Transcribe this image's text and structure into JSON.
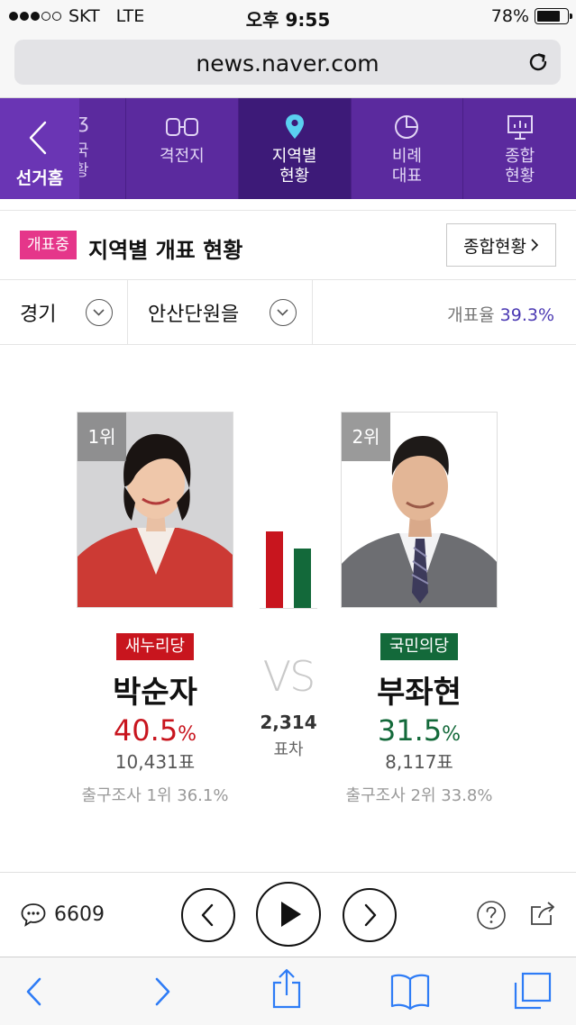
{
  "status": {
    "carrier": "SKT",
    "network": "LTE",
    "time": "오후 9:55",
    "battery": "78%"
  },
  "browser": {
    "url": "news.naver.com"
  },
  "nav": {
    "home_label": "선거홈",
    "partial_label": "국\n황",
    "tabs": [
      {
        "label": "격전지",
        "icon": "versus-icon",
        "active": false
      },
      {
        "label": "지역별\n현황",
        "icon": "location-pin-icon",
        "active": true
      },
      {
        "label": "비례\n대표",
        "icon": "pie-chart-icon",
        "active": false
      },
      {
        "label": "종합\n현황",
        "icon": "board-chart-icon",
        "active": false
      }
    ]
  },
  "header": {
    "badge": "개표중",
    "title": "지역별 개표 현황",
    "summary_button": "종합현황"
  },
  "filters": {
    "region": "경기",
    "district": "안산단원을",
    "count_rate_label": "개표율",
    "count_rate_value": "39.3%"
  },
  "candidates": [
    {
      "rank": "1위",
      "party": "새누리당",
      "name": "박순자",
      "percent": "40.5",
      "pct_sign": "%",
      "votes": "10,431표",
      "exit_poll": "출구조사 1위 36.1%",
      "color": "#c8151e"
    },
    {
      "rank": "2위",
      "party": "국민의당",
      "name": "부좌현",
      "percent": "31.5",
      "pct_sign": "%",
      "votes": "8,117표",
      "exit_poll": "출구조사 2위 33.8%",
      "color": "#13693a"
    }
  ],
  "versus": {
    "vs_text": "VS",
    "diff": "2,314",
    "diff_label": "표차"
  },
  "player": {
    "comment_count": "6609"
  },
  "colors": {
    "nav_bg": "#5b2a9e",
    "nav_active": "#3d1a78",
    "badge_pink": "#e5368a",
    "accent_purple": "#4b39b3",
    "safari_blue": "#2e7cf6"
  }
}
